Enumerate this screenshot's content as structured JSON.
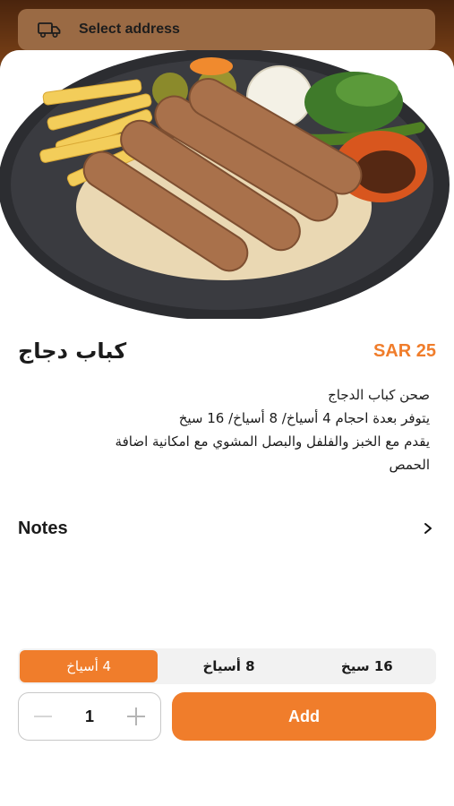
{
  "header": {
    "address_label": "Select address",
    "icon": "truck-icon"
  },
  "product": {
    "image_icon": "food-photo",
    "name": "كباب دجاج",
    "price": "SAR 25",
    "description_lines": [
      "صحن كباب الدجاج",
      "يتوفر بعدة احجام 4 أسياخ/ 8 أسياخ/ 16 سيخ",
      "يقدم مع الخبز والفلفل والبصل المشوي مع امكانية اضافة",
      "الحمص"
    ]
  },
  "notes": {
    "label": "Notes",
    "icon": "chevron-right-icon"
  },
  "sizes": {
    "options": [
      "4 أسياخ",
      "8 أسياخ",
      "16 سيخ"
    ],
    "selected_index": 0
  },
  "cart": {
    "quantity": "1",
    "add_label": "Add"
  },
  "colors": {
    "accent": "#f07d2b",
    "header_bg": "#5a2e12"
  }
}
